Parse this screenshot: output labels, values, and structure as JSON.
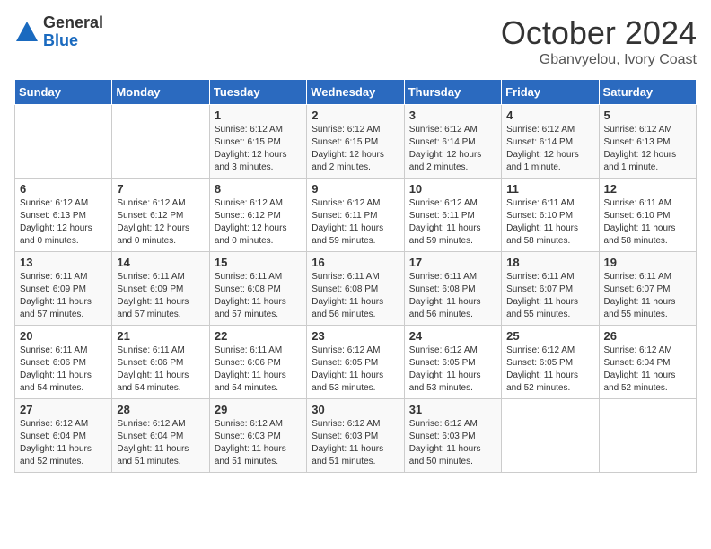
{
  "logo": {
    "general": "General",
    "blue": "Blue"
  },
  "title": "October 2024",
  "subtitle": "Gbanvyelou, Ivory Coast",
  "days_of_week": [
    "Sunday",
    "Monday",
    "Tuesday",
    "Wednesday",
    "Thursday",
    "Friday",
    "Saturday"
  ],
  "weeks": [
    [
      {
        "day": "",
        "info": ""
      },
      {
        "day": "",
        "info": ""
      },
      {
        "day": "1",
        "info": "Sunrise: 6:12 AM\nSunset: 6:15 PM\nDaylight: 12 hours and 3 minutes."
      },
      {
        "day": "2",
        "info": "Sunrise: 6:12 AM\nSunset: 6:15 PM\nDaylight: 12 hours and 2 minutes."
      },
      {
        "day": "3",
        "info": "Sunrise: 6:12 AM\nSunset: 6:14 PM\nDaylight: 12 hours and 2 minutes."
      },
      {
        "day": "4",
        "info": "Sunrise: 6:12 AM\nSunset: 6:14 PM\nDaylight: 12 hours and 1 minute."
      },
      {
        "day": "5",
        "info": "Sunrise: 6:12 AM\nSunset: 6:13 PM\nDaylight: 12 hours and 1 minute."
      }
    ],
    [
      {
        "day": "6",
        "info": "Sunrise: 6:12 AM\nSunset: 6:13 PM\nDaylight: 12 hours and 0 minutes."
      },
      {
        "day": "7",
        "info": "Sunrise: 6:12 AM\nSunset: 6:12 PM\nDaylight: 12 hours and 0 minutes."
      },
      {
        "day": "8",
        "info": "Sunrise: 6:12 AM\nSunset: 6:12 PM\nDaylight: 12 hours and 0 minutes."
      },
      {
        "day": "9",
        "info": "Sunrise: 6:12 AM\nSunset: 6:11 PM\nDaylight: 11 hours and 59 minutes."
      },
      {
        "day": "10",
        "info": "Sunrise: 6:12 AM\nSunset: 6:11 PM\nDaylight: 11 hours and 59 minutes."
      },
      {
        "day": "11",
        "info": "Sunrise: 6:11 AM\nSunset: 6:10 PM\nDaylight: 11 hours and 58 minutes."
      },
      {
        "day": "12",
        "info": "Sunrise: 6:11 AM\nSunset: 6:10 PM\nDaylight: 11 hours and 58 minutes."
      }
    ],
    [
      {
        "day": "13",
        "info": "Sunrise: 6:11 AM\nSunset: 6:09 PM\nDaylight: 11 hours and 57 minutes."
      },
      {
        "day": "14",
        "info": "Sunrise: 6:11 AM\nSunset: 6:09 PM\nDaylight: 11 hours and 57 minutes."
      },
      {
        "day": "15",
        "info": "Sunrise: 6:11 AM\nSunset: 6:08 PM\nDaylight: 11 hours and 57 minutes."
      },
      {
        "day": "16",
        "info": "Sunrise: 6:11 AM\nSunset: 6:08 PM\nDaylight: 11 hours and 56 minutes."
      },
      {
        "day": "17",
        "info": "Sunrise: 6:11 AM\nSunset: 6:08 PM\nDaylight: 11 hours and 56 minutes."
      },
      {
        "day": "18",
        "info": "Sunrise: 6:11 AM\nSunset: 6:07 PM\nDaylight: 11 hours and 55 minutes."
      },
      {
        "day": "19",
        "info": "Sunrise: 6:11 AM\nSunset: 6:07 PM\nDaylight: 11 hours and 55 minutes."
      }
    ],
    [
      {
        "day": "20",
        "info": "Sunrise: 6:11 AM\nSunset: 6:06 PM\nDaylight: 11 hours and 54 minutes."
      },
      {
        "day": "21",
        "info": "Sunrise: 6:11 AM\nSunset: 6:06 PM\nDaylight: 11 hours and 54 minutes."
      },
      {
        "day": "22",
        "info": "Sunrise: 6:11 AM\nSunset: 6:06 PM\nDaylight: 11 hours and 54 minutes."
      },
      {
        "day": "23",
        "info": "Sunrise: 6:12 AM\nSunset: 6:05 PM\nDaylight: 11 hours and 53 minutes."
      },
      {
        "day": "24",
        "info": "Sunrise: 6:12 AM\nSunset: 6:05 PM\nDaylight: 11 hours and 53 minutes."
      },
      {
        "day": "25",
        "info": "Sunrise: 6:12 AM\nSunset: 6:05 PM\nDaylight: 11 hours and 52 minutes."
      },
      {
        "day": "26",
        "info": "Sunrise: 6:12 AM\nSunset: 6:04 PM\nDaylight: 11 hours and 52 minutes."
      }
    ],
    [
      {
        "day": "27",
        "info": "Sunrise: 6:12 AM\nSunset: 6:04 PM\nDaylight: 11 hours and 52 minutes."
      },
      {
        "day": "28",
        "info": "Sunrise: 6:12 AM\nSunset: 6:04 PM\nDaylight: 11 hours and 51 minutes."
      },
      {
        "day": "29",
        "info": "Sunrise: 6:12 AM\nSunset: 6:03 PM\nDaylight: 11 hours and 51 minutes."
      },
      {
        "day": "30",
        "info": "Sunrise: 6:12 AM\nSunset: 6:03 PM\nDaylight: 11 hours and 51 minutes."
      },
      {
        "day": "31",
        "info": "Sunrise: 6:12 AM\nSunset: 6:03 PM\nDaylight: 11 hours and 50 minutes."
      },
      {
        "day": "",
        "info": ""
      },
      {
        "day": "",
        "info": ""
      }
    ]
  ]
}
